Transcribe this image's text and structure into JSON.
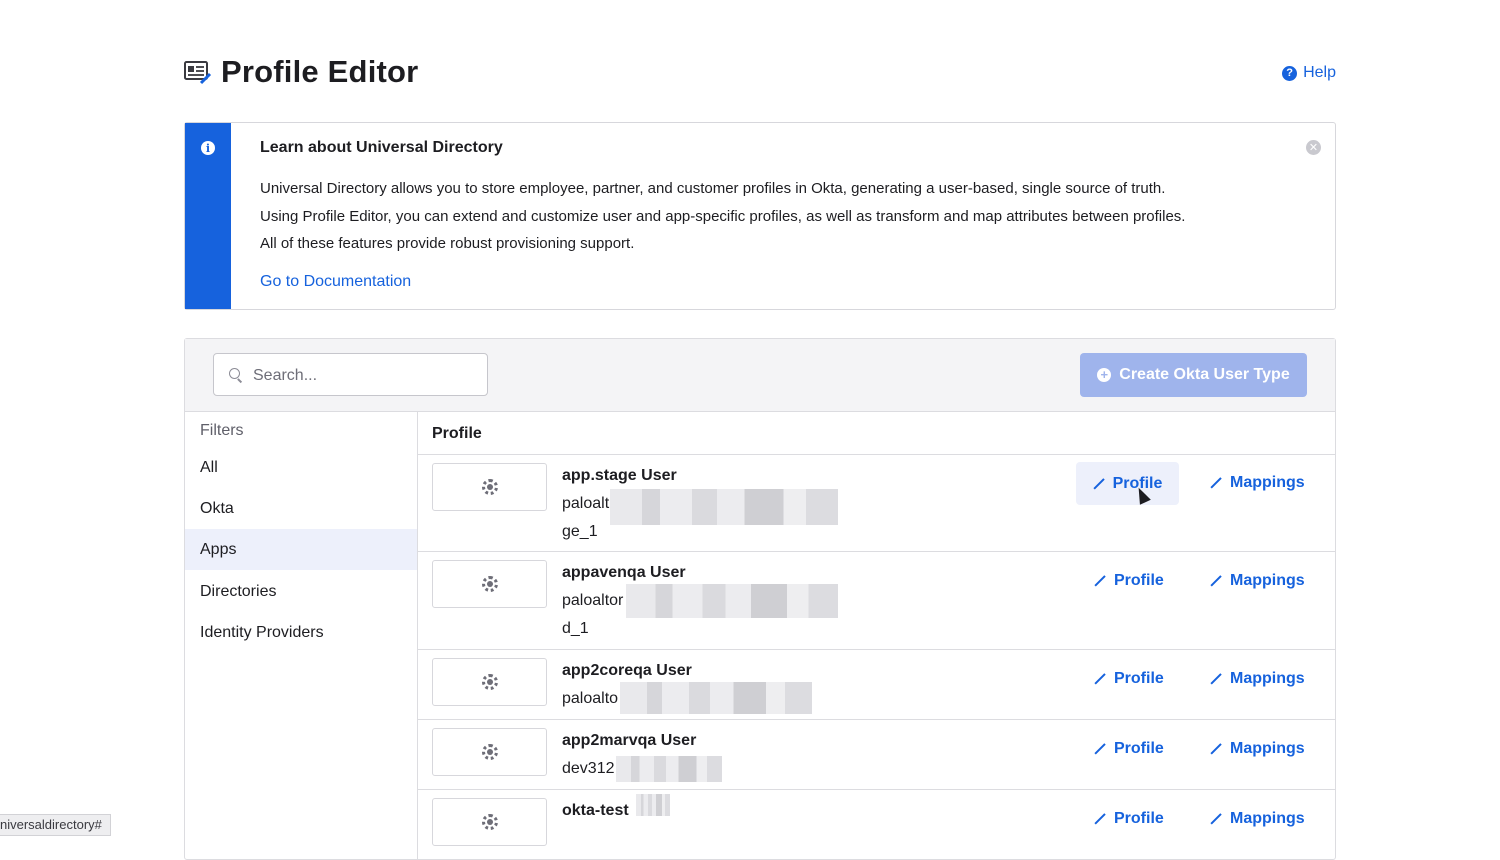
{
  "page": {
    "title": "Profile Editor",
    "help_label": "Help"
  },
  "callout": {
    "title": "Learn about Universal Directory",
    "lines": [
      "Universal Directory allows you to store employee, partner, and customer profiles in Okta, generating a user-based, single source of truth.",
      "Using Profile Editor, you can extend and customize user and app-specific profiles, as well as transform and map attributes between profiles.",
      "All of these features provide robust provisioning support."
    ],
    "doc_link": "Go to Documentation"
  },
  "toolbar": {
    "search_placeholder": "Search...",
    "create_button": "Create Okta User Type"
  },
  "filters": {
    "title": "Filters",
    "items": [
      "All",
      "Okta",
      "Apps",
      "Directories",
      "Identity Providers"
    ],
    "active": "Apps"
  },
  "table": {
    "header": "Profile",
    "profile_label": "Profile",
    "mappings_label": "Mappings",
    "rows": [
      {
        "name": "app.stage User",
        "line1": "paloalt",
        "line2": "ge_1"
      },
      {
        "name": "appavenqa User",
        "line1": "paloaltor",
        "line2": "d_1"
      },
      {
        "name": "app2coreqa User",
        "line1": "paloalto",
        "line2": ""
      },
      {
        "name": "app2marvqa User",
        "line1": "dev312",
        "line2": ""
      },
      {
        "name": "okta-test",
        "line1": "",
        "line2": ""
      }
    ]
  },
  "status_bar": {
    "url": "niversaldirectory#"
  },
  "colors": {
    "accent": "#1662dd",
    "create_button_bg": "#9fb4ec",
    "active_filter_bg": "#edf0fb"
  }
}
